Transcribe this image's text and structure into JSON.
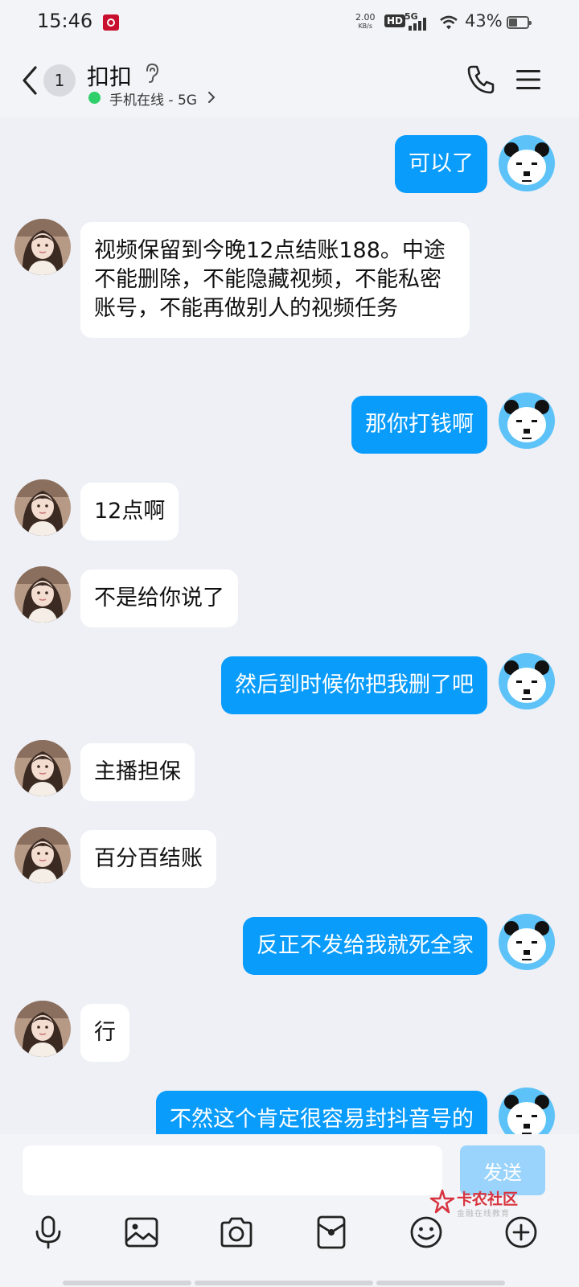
{
  "status_bar": {
    "time": "15:46",
    "speed_value": "2.00",
    "speed_unit": "KB/s",
    "hd": "HD",
    "network": "5G",
    "battery": "43%"
  },
  "header": {
    "unread_count": "1",
    "contact_name": "扣扣",
    "online_status": "手机在线 - 5G"
  },
  "messages": [
    {
      "side": "self",
      "text": "可以了"
    },
    {
      "side": "peer",
      "text": "视频保留到今晚12点结账188。中途不能删除，不能隐藏视频，不能私密账号，不能再做别人的视频任务"
    },
    {
      "side": "self",
      "text": "那你打钱啊"
    },
    {
      "side": "peer",
      "text": "12点啊"
    },
    {
      "side": "peer",
      "text": "不是给你说了"
    },
    {
      "side": "self",
      "text": "然后到时候你把我删了吧"
    },
    {
      "side": "peer",
      "text": "主播担保"
    },
    {
      "side": "peer",
      "text": "百分百结账"
    },
    {
      "side": "self",
      "text": "反正不发给我就死全家"
    },
    {
      "side": "peer",
      "text": "行"
    },
    {
      "side": "self",
      "text": "不然这个肯定很容易封抖音号的"
    }
  ],
  "input": {
    "value": "",
    "send_label": "发送"
  },
  "watermark": {
    "title": "卡农社区",
    "subtitle": "金融在线教育"
  },
  "theme": {
    "self_bubble": "#0a9cfb",
    "peer_bubble": "#ffffff",
    "online": "#2fd06b",
    "send_disabled": "#9ad3fb"
  }
}
